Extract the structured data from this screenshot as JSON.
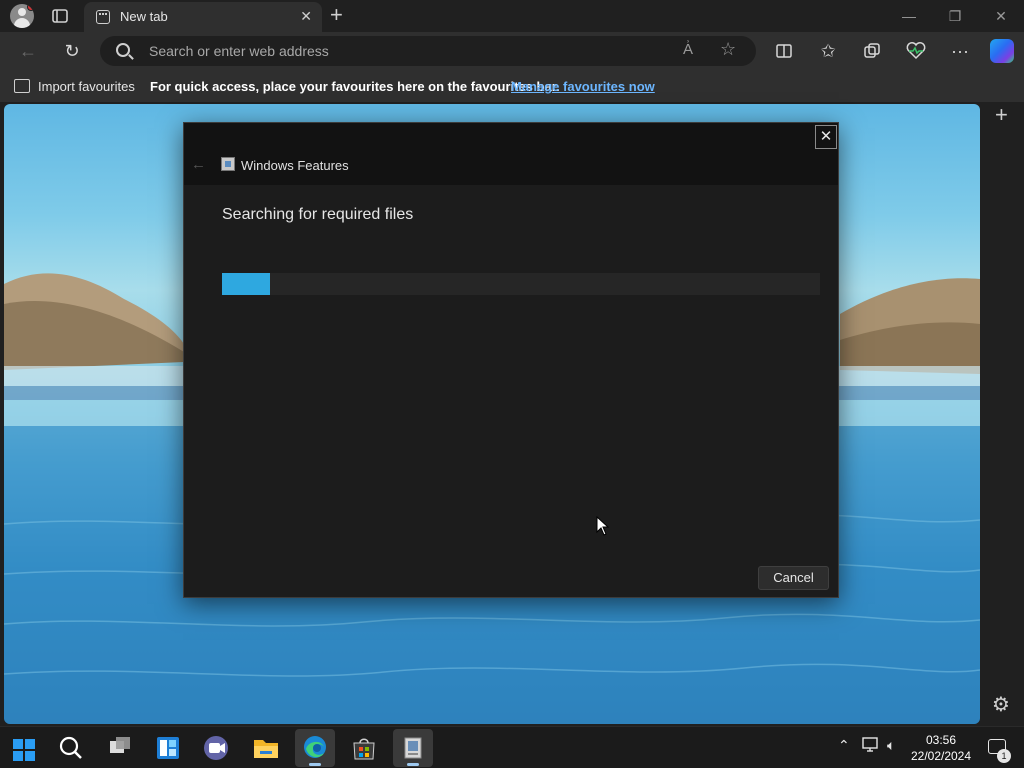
{
  "browser": {
    "tab": {
      "label": "New tab",
      "icon": "newtab-page-icon"
    },
    "address_bar": {
      "placeholder": "Search or enter web address"
    },
    "favorites_bar": {
      "import_label": "Import favourites",
      "message": "For quick access, place your favourites here on the favourites bar.",
      "manage_link": "Manage favourites now"
    }
  },
  "dialog": {
    "title": "Windows Features",
    "status": "Searching for required files",
    "progress_fraction": 0.08,
    "cancel_label": "Cancel",
    "accent_color": "#2ea8e0"
  },
  "taskbar": {
    "items": [
      "start",
      "search",
      "task-view",
      "widgets",
      "teams-chat",
      "file-explorer",
      "edge",
      "microsoft-store",
      "windows-features"
    ],
    "clock": {
      "time": "03:56",
      "date": "22/02/2024"
    },
    "notification_count": "1"
  }
}
